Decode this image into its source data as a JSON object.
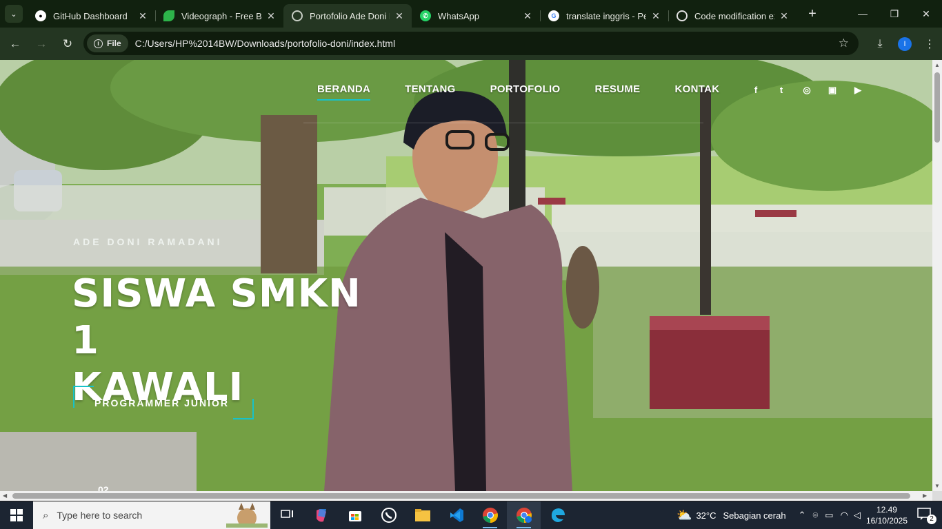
{
  "browser": {
    "tabs": [
      {
        "title": "GitHub Dashboard",
        "favicon": "github-icon",
        "active": false
      },
      {
        "title": "Videograph - Free Bo",
        "favicon": "leaf-icon",
        "active": false
      },
      {
        "title": "Portofolio Ade Doni R",
        "favicon": "globe-icon",
        "active": true
      },
      {
        "title": "WhatsApp",
        "favicon": "whatsapp-icon",
        "active": false
      },
      {
        "title": "translate inggris - Pe",
        "favicon": "google-icon",
        "active": false
      },
      {
        "title": "Code modification ex",
        "favicon": "openai-icon",
        "active": false
      }
    ],
    "address": {
      "chip_label": "File",
      "url": "C:/Users/HP%2014BW/Downloads/portofolio-doni/index.html"
    },
    "profile_initial": "I"
  },
  "page": {
    "nav": [
      {
        "label": "BERANDA",
        "active": true
      },
      {
        "label": "TENTANG",
        "active": false
      },
      {
        "label": "PORTOFOLIO",
        "active": false
      },
      {
        "label": "RESUME",
        "active": false
      },
      {
        "label": "KONTAK",
        "active": false
      }
    ],
    "social": [
      "facebook-icon",
      "twitter-icon",
      "dribbble-icon",
      "instagram-icon",
      "youtube-icon"
    ],
    "eyebrow": "ADE DONI RAMADANI",
    "headline_line1": "SISWA SMKN 1",
    "headline_line2": "KAWALI",
    "cta": "PROGRAMMER JUNIOR",
    "counter": "02",
    "accent": "#17c2c9"
  },
  "taskbar": {
    "search_placeholder": "Type here to search",
    "weather": {
      "temp": "32°C",
      "desc": "Sebagian cerah"
    },
    "time": "12.49",
    "date": "16/10/2025",
    "notifications": "2"
  }
}
